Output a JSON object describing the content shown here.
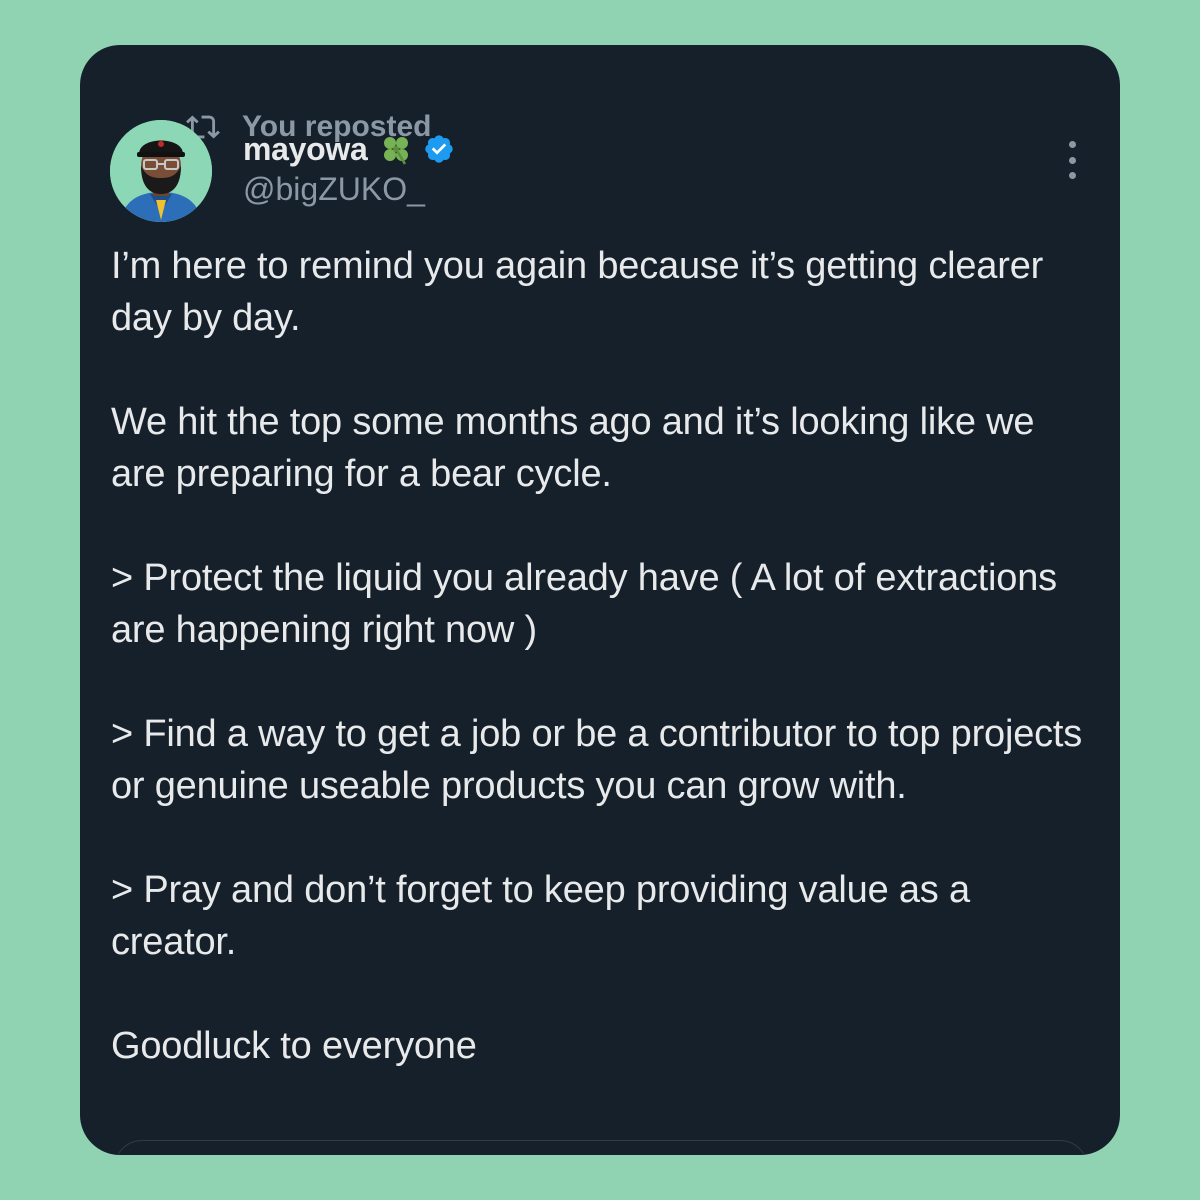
{
  "repost": {
    "label": "You reposted",
    "icon": "repost-icon"
  },
  "author": {
    "display_name": "mayowa",
    "emoji_icon": "four-leaf-clover-icon",
    "verified_icon": "verified-badge-icon",
    "handle": "@bigZUKO_",
    "avatar_icon": "avatar"
  },
  "menu": {
    "icon": "more-options-icon"
  },
  "tweet": {
    "paragraphs": [
      "I’m here to remind you again because it’s getting clearer day by day.",
      "We hit the top some months ago and it’s looking like we are preparing for a bear cycle.",
      "> Protect the liquid you already have ( A lot of extractions are happening right now )",
      "> Find a way to get a job or be a contributor to top projects or genuine useable products you can grow with.",
      "> Pray and don’t forget to keep providing value as a creator.",
      "Goodluck to everyone"
    ]
  },
  "colors": {
    "background": "#8fd3b2",
    "card": "#16202a",
    "text_primary": "#e7e9ea",
    "text_secondary": "#8b98a5",
    "verified": "#1d9bf0"
  }
}
